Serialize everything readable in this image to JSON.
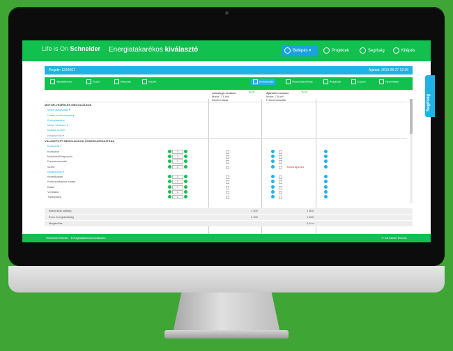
{
  "brand": {
    "life": "Life is On",
    "name": "Schneider"
  },
  "app_title": {
    "light": "Energiatakarékos",
    "bold": "kiválasztó"
  },
  "topbar": {
    "user": "Belépés",
    "actions": [
      "Projektek",
      "Segítség",
      "Kilépés"
    ]
  },
  "infobar": {
    "left": "Projekt: 1234567",
    "right": "Ajánlat: 2019.05.27 12:35"
  },
  "actionbar": [
    {
      "label": "Ajánlatkérés",
      "highlight": false
    },
    {
      "label": "Új sor",
      "highlight": false
    },
    {
      "label": "Másolás",
      "highlight": false
    },
    {
      "label": "Import",
      "highlight": false
    },
    {
      "label": "Kiválasztás",
      "highlight": true
    },
    {
      "label": "Összehasonlítás",
      "highlight": false
    },
    {
      "label": "Árajánlat",
      "highlight": false
    },
    {
      "label": "Export",
      "highlight": false
    },
    {
      "label": "Nyomtatás",
      "highlight": false
    }
  ],
  "columns": [
    {
      "title": "Jelenlegi rendszer",
      "sub1": "Motor: 7,5 kW",
      "sub2": "Direkt indítás"
    },
    {
      "title": "Ajánlott rendszer",
      "sub1": "Motor: 7,5 kW",
      "sub2": "Frekvenciaváltó"
    }
  ],
  "rows": [
    {
      "type": "sec",
      "label": "MOTOR-VEZÉRLÉS MEGOLDÁSOK"
    },
    {
      "type": "link",
      "label": "Motor alapadatai"
    },
    {
      "type": "link",
      "label": "Üzemi körülmények"
    },
    {
      "type": "link",
      "label": "Energiaárak"
    },
    {
      "type": "link",
      "label": "Motor védelme"
    },
    {
      "type": "link",
      "label": "Indítási mód"
    },
    {
      "type": "link",
      "label": "Kiegészítők"
    },
    {
      "type": "sec",
      "label": "VÁLASZTOTT MEGOLDÁSOK ÖSSZEHASONLÍTÁSA"
    },
    {
      "type": "link",
      "label": "Eszközök"
    },
    {
      "type": "item",
      "label": "Kontaktor",
      "qty": "1",
      "warn": ""
    },
    {
      "type": "item",
      "label": "Motorvédő kapcsoló",
      "qty": "1",
      "warn": ""
    },
    {
      "type": "item",
      "label": "Frekvenciaváltó",
      "qty": "1",
      "warn": ""
    },
    {
      "type": "item",
      "label": "Szűrő",
      "qty": "1",
      "warn": "Nincs ajánlva"
    },
    {
      "type": "link",
      "label": "Kiegészítők"
    },
    {
      "type": "item",
      "label": "Kezelőpanel",
      "qty": "1",
      "warn": ""
    },
    {
      "type": "item",
      "label": "Kommunikációs kártya",
      "qty": "1",
      "warn": ""
    },
    {
      "type": "item",
      "label": "Kábel",
      "qty": "1",
      "warn": ""
    },
    {
      "type": "item",
      "label": "Ventilátor",
      "qty": "1",
      "warn": ""
    },
    {
      "type": "item",
      "label": "Tápegység",
      "qty": "1",
      "warn": ""
    }
  ],
  "totals": [
    {
      "label": "Bekerülési költség",
      "v1": "1 200",
      "v2": "1 800"
    },
    {
      "label": "Éves energiaköltség",
      "v1": "2 400",
      "v2": "1 500"
    },
    {
      "label": "Megtérülés",
      "v1": "",
      "v2": "0,8 év"
    }
  ],
  "sidetab": "Segítség",
  "footer": {
    "left": "Schneider Electric · Energiatakarékos kiválasztó",
    "right": "© Schneider Electric"
  }
}
